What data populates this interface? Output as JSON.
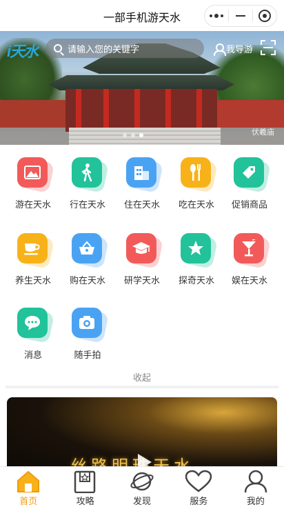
{
  "titlebar": {
    "title": "一部手机游天水"
  },
  "banner": {
    "logo_text": "i天水",
    "search_placeholder": "请输入您的关键字",
    "guide_label": "我导游",
    "caption": "伏羲庙",
    "slide_count": 3,
    "active_slide": 2
  },
  "grid": {
    "items": [
      {
        "label": "游在天水",
        "icon": "mountain-icon",
        "color": "#f25a5a"
      },
      {
        "label": "行在天水",
        "icon": "walking-person-icon",
        "color": "#22c29a"
      },
      {
        "label": "住在天水",
        "icon": "building-icon",
        "color": "#4aa3f2"
      },
      {
        "label": "吃在天水",
        "icon": "fork-knife-icon",
        "color": "#f7b21a"
      },
      {
        "label": "促销商品",
        "icon": "tag-icon",
        "color": "#22c29a"
      },
      {
        "label": "养生天水",
        "icon": "tea-cup-icon",
        "color": "#f7b21a"
      },
      {
        "label": "购在天水",
        "icon": "shopping-basket-icon",
        "color": "#4aa3f2"
      },
      {
        "label": "研学天水",
        "icon": "graduation-cap-icon",
        "color": "#f25a5a"
      },
      {
        "label": "探奇天水",
        "icon": "star-icon",
        "color": "#22c29a"
      },
      {
        "label": "娱在天水",
        "icon": "cocktail-icon",
        "color": "#f25a5a"
      },
      {
        "label": "消息",
        "icon": "chat-bubble-icon",
        "color": "#22c29a"
      },
      {
        "label": "随手拍",
        "icon": "camera-icon",
        "color": "#4aa3f2"
      }
    ]
  },
  "collapse_label": "收起",
  "video": {
    "overlay_text": "丝路明珠天水"
  },
  "tabbar": {
    "tabs": [
      {
        "label": "首页",
        "icon": "home-icon",
        "active": true
      },
      {
        "label": "攻略",
        "icon": "guide-book-icon",
        "active": false
      },
      {
        "label": "发现",
        "icon": "planet-icon",
        "active": false
      },
      {
        "label": "服务",
        "icon": "heart-icon",
        "active": false
      },
      {
        "label": "我的",
        "icon": "user-icon",
        "active": false
      }
    ],
    "active_color": "#f29a0e"
  }
}
